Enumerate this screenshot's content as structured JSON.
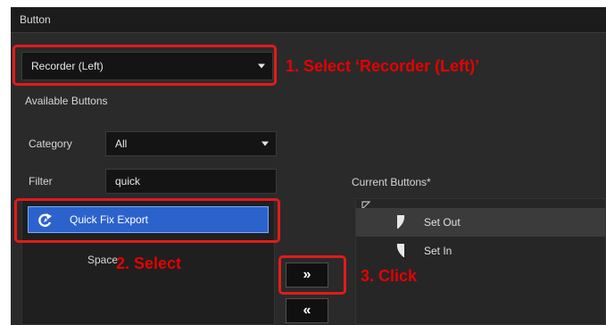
{
  "panel": {
    "title": "Button"
  },
  "preset_dropdown": {
    "value": "Recorder (Left)"
  },
  "available_buttons": {
    "label": "Available Buttons"
  },
  "category": {
    "label": "Category",
    "value": "All"
  },
  "filter": {
    "label": "Filter",
    "value": "quick"
  },
  "available_list": {
    "selected_item": "Quick Fix Export",
    "space_item": "Space"
  },
  "transfer_buttons": {
    "add_label": "»",
    "remove_label": "«"
  },
  "current_buttons": {
    "label": "Current Buttons*",
    "items": [
      {
        "label": "Set Out",
        "icon": "set-out-icon"
      },
      {
        "label": "Set In",
        "icon": "set-in-icon"
      }
    ]
  },
  "annotations": {
    "step1": "1. Select ‘Recorder (Left)’",
    "step2": "2. Select",
    "step3": "3. Click"
  },
  "colors": {
    "annotation_red": "#e31a1a",
    "selection_blue": "#2c62cc",
    "panel_bg": "#2a2a2a"
  }
}
